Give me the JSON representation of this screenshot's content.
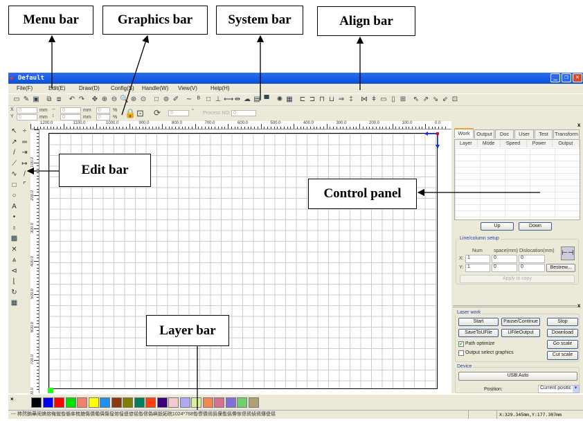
{
  "callouts": {
    "menu_bar": "Menu bar",
    "graphics_bar": "Graphics bar",
    "system_bar": "System bar",
    "align_bar": "Align bar",
    "edit_bar": "Edit bar",
    "control_panel": "Control panel",
    "layer_bar": "Layer bar"
  },
  "window": {
    "title": "Default",
    "minimize": "_",
    "restore": "❐",
    "close": "✕"
  },
  "menu": [
    "File(F)",
    "Edit(E)",
    "Draw(D)",
    "Config(S)",
    "Handle(W)",
    "View(V)",
    "Help(H)"
  ],
  "toolbar_icons": [
    {
      "name": "new-file-icon",
      "g": "▭"
    },
    {
      "name": "open-file-icon",
      "g": "✎"
    },
    {
      "name": "save-icon",
      "g": "▣"
    },
    {
      "name": "import-icon",
      "g": "⧉"
    },
    {
      "name": "export-icon",
      "g": "⧈"
    },
    {
      "name": "undo-icon",
      "g": "↶"
    },
    {
      "name": "redo-icon",
      "g": "↷"
    },
    {
      "name": "pan-icon",
      "g": "✥"
    },
    {
      "name": "zoom-in-icon",
      "g": "⊕"
    },
    {
      "name": "zoom-out-icon",
      "g": "⊖"
    },
    {
      "name": "zoom-window-icon",
      "g": "🔍"
    },
    {
      "name": "zoom-all-icon",
      "g": "⊛"
    },
    {
      "name": "zoom-page-icon",
      "g": "⊙"
    },
    {
      "name": "select-rect-icon",
      "g": "□"
    },
    {
      "name": "node-edit-icon",
      "g": "⊚"
    },
    {
      "name": "pen-icon",
      "g": "✐"
    },
    {
      "name": "curve-icon",
      "g": "∼"
    },
    {
      "name": "bitmap-icon",
      "g": "ᴮ"
    },
    {
      "name": "frame-icon",
      "g": "□"
    },
    {
      "name": "tree-icon",
      "g": "⊥"
    },
    {
      "name": "width-icon",
      "g": "⟷"
    },
    {
      "name": "height-icon",
      "g": "⇹"
    },
    {
      "name": "cloud-icon",
      "g": "☁"
    },
    {
      "name": "doc-icon",
      "g": "▤"
    },
    {
      "name": "monitor-icon",
      "g": "▀"
    },
    {
      "name": "laser-icon",
      "g": "✺"
    },
    {
      "name": "params-icon",
      "g": "▦"
    },
    {
      "name": "align-left-icon",
      "g": "⊏"
    },
    {
      "name": "align-right-icon",
      "g": "⊐"
    },
    {
      "name": "align-top-icon",
      "g": "⊓"
    },
    {
      "name": "align-bottom-icon",
      "g": "⊔"
    },
    {
      "name": "align-hcenter-icon",
      "g": "⇒"
    },
    {
      "name": "align-vcenter-icon",
      "g": "‡"
    },
    {
      "name": "equal-hspace-icon",
      "g": "⋈"
    },
    {
      "name": "equal-vspace-icon",
      "g": "ǂ"
    },
    {
      "name": "same-width-icon",
      "g": "▭"
    },
    {
      "name": "same-height-icon",
      "g": "▯"
    },
    {
      "name": "same-size-icon",
      "g": "⊞"
    },
    {
      "name": "top-left-icon",
      "g": "⇖"
    },
    {
      "name": "top-right-icon",
      "g": "⇗"
    },
    {
      "name": "bottom-right-icon",
      "g": "⇘"
    },
    {
      "name": "bottom-left-icon",
      "g": "⇙"
    },
    {
      "name": "center-icon",
      "g": "⊡"
    }
  ],
  "props": {
    "x_label": "X",
    "y_label": "Y",
    "unit": "mm",
    "pct": "%",
    "x_value": "0",
    "y_value": "0",
    "w_value": "0",
    "h_value": "0",
    "sx_value": "0",
    "sy_value": "0",
    "angle_value": "0",
    "degree": "°",
    "process_label": "Process NO:",
    "process_value": "0"
  },
  "hruler": [
    "1200.0",
    "1100.0",
    "1000.0",
    "900.0",
    "800.0",
    "700.0",
    "600.0",
    "500.0",
    "400.0",
    "300.0",
    "200.0",
    "100.0",
    "0.0"
  ],
  "vruler": [
    "100.0",
    "200.0",
    "300.0",
    "400.0",
    "500.0",
    "600.0",
    "700.0",
    "800.0"
  ],
  "edit_icons": [
    {
      "name": "select-icon",
      "g": "↖"
    },
    {
      "name": "node-icon",
      "g": "↗"
    },
    {
      "name": "line-icon",
      "g": "/"
    },
    {
      "name": "polyline-icon",
      "g": "⟋"
    },
    {
      "name": "curve-icon",
      "g": "∿"
    },
    {
      "name": "rectangle-icon",
      "g": "□"
    },
    {
      "name": "ellipse-icon",
      "g": "○"
    },
    {
      "name": "text-icon",
      "g": "A"
    },
    {
      "name": "point-icon",
      "g": "•"
    },
    {
      "name": "marker-icon",
      "g": "♁"
    },
    {
      "name": "array-icon",
      "g": "▩"
    },
    {
      "name": "delete-icon",
      "g": "✕"
    },
    {
      "name": "mirror-h-icon",
      "g": "⩓"
    },
    {
      "name": "mirror-v-icon",
      "g": "⊲"
    },
    {
      "name": "origin-icon",
      "g": "⌊"
    },
    {
      "name": "rotate-icon",
      "g": "↻"
    },
    {
      "name": "grid-icon",
      "g": "▦"
    }
  ],
  "edit_icons2": [
    {
      "name": "split-icon",
      "g": "÷"
    },
    {
      "name": "join-icon",
      "g": "═"
    },
    {
      "name": "h-distribute-icon",
      "g": "⇥"
    },
    {
      "name": "v-distribute-icon",
      "g": "↦"
    },
    {
      "name": "line-tool-icon",
      "g": "/"
    },
    {
      "name": "corner-icon",
      "g": "⌜"
    }
  ],
  "panel": {
    "tabs": [
      "Work",
      "Output",
      "Doc",
      "User",
      "Test",
      "Transform"
    ],
    "columns": [
      "Layer",
      "Mode",
      "Speed",
      "Power",
      "Output"
    ],
    "up": "Up",
    "down": "Down",
    "line_setup": "Line/column setup",
    "num": "Num",
    "space": "space(mm)",
    "dislocation": "Dislocation(mm)",
    "x_label": "X:",
    "y_label": "Y:",
    "x_num": "1",
    "x_space": "0",
    "x_disl": "0",
    "y_num": "1",
    "y_space": "0",
    "y_disl": "0",
    "bestrew": "Bestrew...",
    "apply": "Apply to copy",
    "laser_work": "Laser work",
    "start": "Start",
    "pause": "Pause/Continue",
    "stop": "Stop",
    "save_ufile": "SaveToUFile",
    "ufile_output": "UFileOutput",
    "download": "Download",
    "path_optimize": "Path optimize",
    "path_optimize_checked": true,
    "output_select": "Output select graphics",
    "output_select_checked": false,
    "go_scale": "Go scale",
    "cut_scale": "Cut scale",
    "device": "Device",
    "usb": "USB:Auto",
    "position_label": "Position:",
    "position_value": "Current positic",
    "close": "x"
  },
  "layer_colors": [
    "#000000",
    "#0000ff",
    "#ff0000",
    "#00e000",
    "#f08070",
    "#ffff00",
    "#2090f0",
    "#8b3a10",
    "#808000",
    "#008060",
    "#ff4010",
    "#3a0080",
    "#f8c8d0",
    "#b0a8f0",
    "#d8f0a0",
    "#f08850",
    "#d87090",
    "#8070d8",
    "#70d070",
    "#b0a078"
  ],
  "status": {
    "message": "--- 柿然鈉華闹熇傛俺僦偺偱傘梳摝傷僨僶偊傷偟傛偟偍偐傜偺偲偽嶼挀妬晥1024*768偺僄僨傿僞僷儖僞僀傢偲傿偵傿傳偍傜",
    "coords": "X:329.345mm,Y:177.307mm"
  }
}
